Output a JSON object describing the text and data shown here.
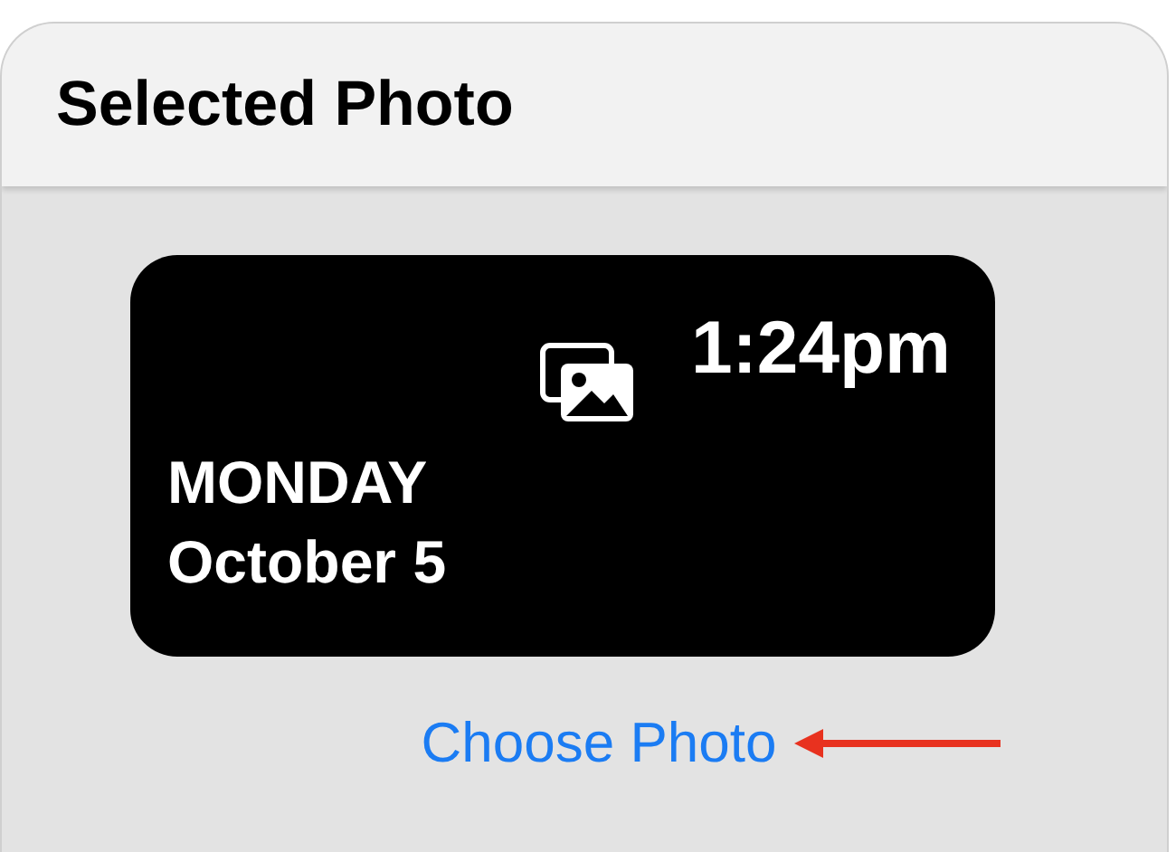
{
  "header": {
    "title": "Selected Photo"
  },
  "widget": {
    "time": "1:24pm",
    "day": "MONDAY",
    "date": "October 5"
  },
  "link": {
    "label": "Choose Photo"
  }
}
